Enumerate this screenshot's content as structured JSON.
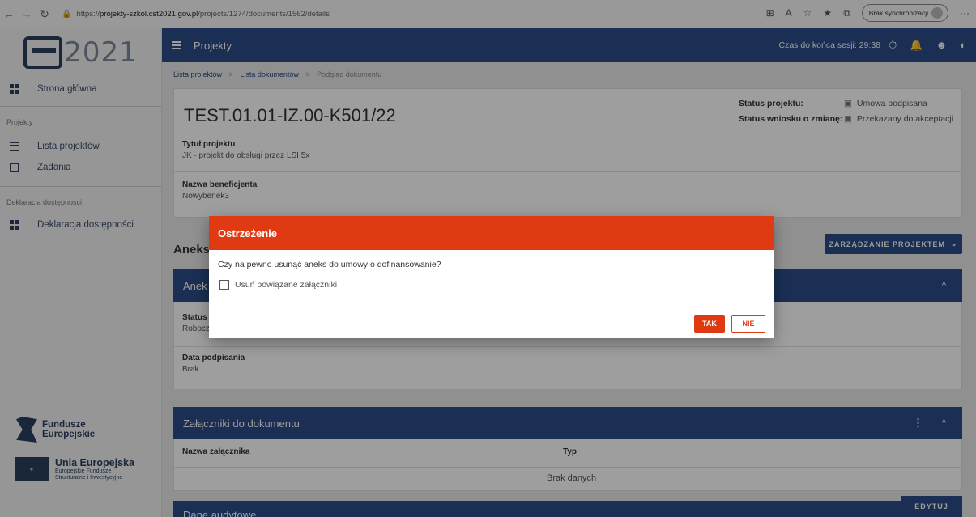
{
  "browser": {
    "url_prefix": "https://",
    "url_host": "projekty-szkol.cst2021.gov.pl",
    "url_path": "/projects/1274/documents/1562/details",
    "sync_label": "Brak synchronizacji"
  },
  "sidebar": {
    "logo_text": "2021",
    "home": "Strona główna",
    "section_projects": "Projekty",
    "projects_list": "Lista projektów",
    "tasks": "Zadania",
    "section_access": "Deklaracja dostępności",
    "access_item": "Deklaracja dostępności",
    "fe_logo_line1": "Fundusze",
    "fe_logo_line2": "Europejskie",
    "ue_logo_title": "Unia Europejska",
    "ue_logo_line1": "Europejskie Fundusze",
    "ue_logo_line2": "Strukturalne i Inwestycyjne"
  },
  "header": {
    "title": "Projekty",
    "session_label": "Czas do końca sesji:",
    "session_time": "29:38"
  },
  "breadcrumb": {
    "item1": "Lista projektów",
    "item2": "Lista dokumentów",
    "current": "Podgląd dokumentu",
    "separator": ">"
  },
  "document": {
    "code": "TEST.01.01-IZ.00-K501/22",
    "status_project_label": "Status projektu:",
    "status_project_value": "Umowa podpisana",
    "status_change_label": "Status wniosku o zmianę:",
    "status_change_value": "Przekazany do akceptacji",
    "title_label": "Tytuł projektu",
    "title_value": "JK - projekt do obsługi przez LSI 5x",
    "beneficiary_label": "Nazwa beneficjenta",
    "beneficiary_value": "Nowybenek3"
  },
  "aneks": {
    "heading": "Aneks",
    "manage_button": "ZARZĄDZANIE PROJEKTEM",
    "panel_title": "Anek",
    "status_label": "Status",
    "status_value": "Robocz",
    "date_label": "Data podpisania",
    "date_value": "Brak"
  },
  "attachments": {
    "panel_title": "Załączniki do dokumentu",
    "col_name": "Nazwa załącznika",
    "col_type": "Typ",
    "empty": "Brak danych"
  },
  "audit": {
    "panel_title": "Dane audytowe",
    "edit_button": "EDYTUJ"
  },
  "dialog": {
    "title": "Ostrzeżenie",
    "message": "Czy na pewno usunąć aneks do umowy o dofinansowanie?",
    "checkbox_label": "Usuń powiązane załączniki",
    "checkbox_checked": false,
    "yes": "TAK",
    "no": "NIE"
  },
  "colors": {
    "primary": "#2b4d87",
    "warning": "#e03a12"
  }
}
